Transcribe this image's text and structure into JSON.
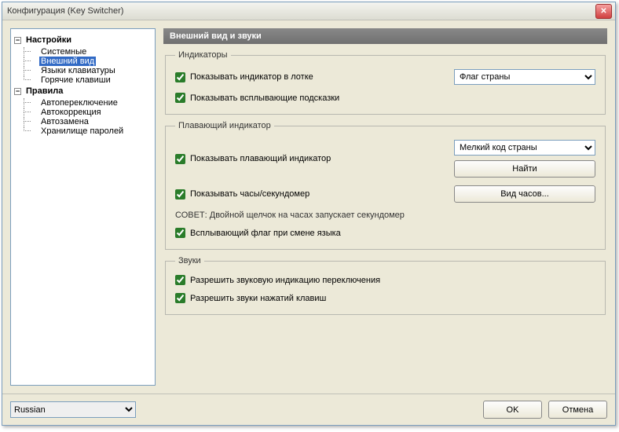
{
  "window": {
    "title": "Конфигурация (Key Switcher)"
  },
  "tree": {
    "root1": "Настройки",
    "root1_items": [
      "Системные",
      "Внешний вид",
      "Языки клавиатуры",
      "Горячие клавиши"
    ],
    "root2": "Правила",
    "root2_items": [
      "Автопереключение",
      "Автокоррекция",
      "Автозамена",
      "Хранилище паролей"
    ],
    "selected": "Внешний вид"
  },
  "page": {
    "title": "Внешний вид и звуки",
    "group_indicators": {
      "legend": "Индикаторы",
      "chk_tray": "Показывать индикатор в лотке",
      "chk_tooltips": "Показывать всплывающие подсказки",
      "combo_selected": "Флаг страны"
    },
    "group_floating": {
      "legend": "Плавающий индикатор",
      "chk_show": "Показывать плавающий индикатор",
      "combo_selected": "Мелкий код страны",
      "btn_find": "Найти",
      "chk_clock": "Показывать часы/секундомер",
      "btn_clockstyle": "Вид часов...",
      "hint": "СОВЕТ:  Двойной щелчок на часах запускает секундомер",
      "chk_flag": "Всплывающий флаг при смене языка"
    },
    "group_sounds": {
      "legend": "Звуки",
      "chk_switch": "Разрешить звуковую индикацию переключения",
      "chk_keys": "Разрешить звуки нажатий клавиш"
    }
  },
  "footer": {
    "lang_selected": "Russian",
    "ok": "OK",
    "cancel": "Отмена"
  }
}
